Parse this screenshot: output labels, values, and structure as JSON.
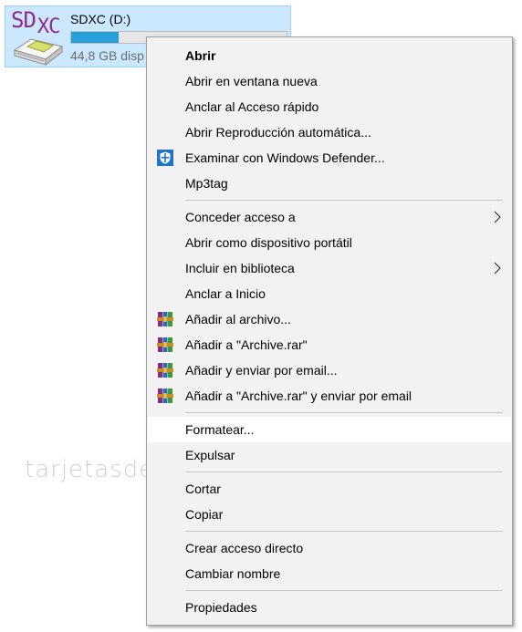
{
  "drive": {
    "logo_sd": "SD",
    "logo_xc": "XC",
    "name": "SDXC (D:)",
    "free_text": "44,8 GB disp",
    "used_fraction": 0.22,
    "bar_color": "#26a0da",
    "selection_color": "#cce8ff"
  },
  "menu": {
    "group1": {
      "open": "Abrir",
      "open_new_window": "Abrir en ventana nueva",
      "pin_quick_access": "Anclar al Acceso rápido",
      "autoplay": "Abrir Reproducción automática...",
      "defender": "Examinar con Windows Defender...",
      "mp3tag": "Mp3tag"
    },
    "group2": {
      "give_access": "Conceder acceso a",
      "open_portable": "Abrir como dispositivo portátil",
      "include_library": "Incluir en biblioteca",
      "pin_start": "Anclar a Inicio",
      "add_archive": "Añadir al archivo...",
      "add_archive_rar": "Añadir a \"Archive.rar\"",
      "add_email": "Añadir y enviar por email...",
      "add_rar_email": "Añadir a \"Archive.rar\" y enviar por email"
    },
    "group3": {
      "format": "Formatear...",
      "eject": "Expulsar"
    },
    "group4": {
      "cut": "Cortar",
      "copy": "Copiar"
    },
    "group5": {
      "create_shortcut": "Crear acceso directo",
      "rename": "Cambiar nombre"
    },
    "group6": {
      "properties": "Propiedades"
    },
    "icons": {
      "defender": "windows-defender-shield-icon",
      "winrar": "winrar-books-icon",
      "submenu": "chevron-right-icon"
    }
  },
  "watermark": "tarjetasdememoria.info"
}
